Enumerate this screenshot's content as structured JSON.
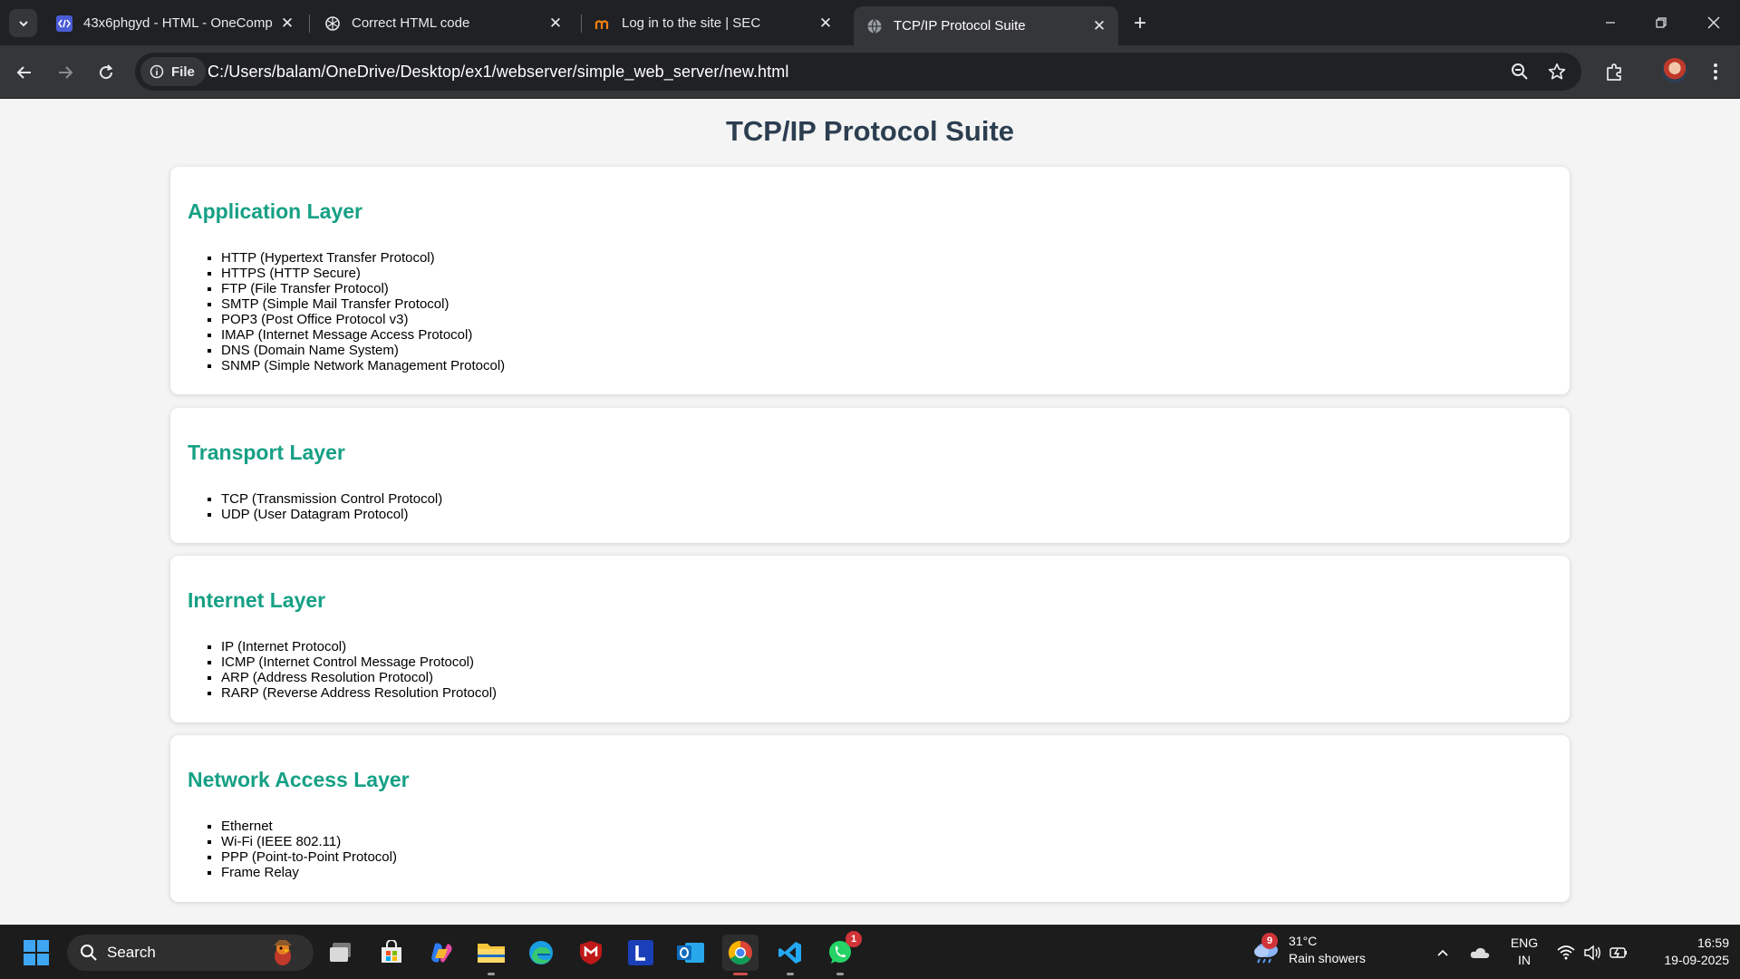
{
  "browser": {
    "tabs": [
      {
        "title": "43x6phgyd - HTML - OneComp",
        "icon": "onecompiler-icon"
      },
      {
        "title": "Correct HTML code",
        "icon": "chatgpt-icon"
      },
      {
        "title": "Log in to the site | SEC",
        "icon": "moodle-icon"
      },
      {
        "title": "TCP/IP Protocol Suite",
        "icon": "globe-icon",
        "active": true
      }
    ],
    "address_chip": "File",
    "url": "C:/Users/balam/OneDrive/Desktop/ex1/webserver/simple_web_server/new.html"
  },
  "page": {
    "title": "TCP/IP Protocol Suite",
    "layers": [
      {
        "heading": "Application Layer",
        "items": [
          "HTTP (Hypertext Transfer Protocol)",
          "HTTPS (HTTP Secure)",
          "FTP (File Transfer Protocol)",
          "SMTP (Simple Mail Transfer Protocol)",
          "POP3 (Post Office Protocol v3)",
          "IMAP (Internet Message Access Protocol)",
          "DNS (Domain Name System)",
          "SNMP (Simple Network Management Protocol)"
        ]
      },
      {
        "heading": "Transport Layer",
        "items": [
          "TCP (Transmission Control Protocol)",
          "UDP (User Datagram Protocol)"
        ]
      },
      {
        "heading": "Internet Layer",
        "items": [
          "IP (Internet Protocol)",
          "ICMP (Internet Control Message Protocol)",
          "ARP (Address Resolution Protocol)",
          "RARP (Reverse Address Resolution Protocol)"
        ]
      },
      {
        "heading": "Network Access Layer",
        "items": [
          "Ethernet",
          "Wi-Fi (IEEE 802.11)",
          "PPP (Point-to-Point Protocol)",
          "Frame Relay"
        ]
      }
    ]
  },
  "taskbar": {
    "search_label": "Search",
    "apps": [
      "task-view-icon",
      "microsoft-store-icon",
      "copilot-icon",
      "file-explorer-icon",
      "edge-icon",
      "mcafee-icon",
      "l-app-icon",
      "outlook-icon",
      "chrome-icon",
      "vscode-icon",
      "whatsapp-icon"
    ],
    "whatsapp_badge": "1",
    "weather": {
      "badge": "9",
      "temp": "31°C",
      "condition": "Rain showers"
    },
    "language": {
      "line1": "ENG",
      "line2": "IN"
    },
    "clock": {
      "time": "16:59",
      "date": "19-09-2025"
    }
  },
  "colors": {
    "heading": "#2c3e50",
    "layer_heading": "#16a085",
    "page_bg": "#f4f4f4",
    "card_bg": "#ffffff"
  }
}
